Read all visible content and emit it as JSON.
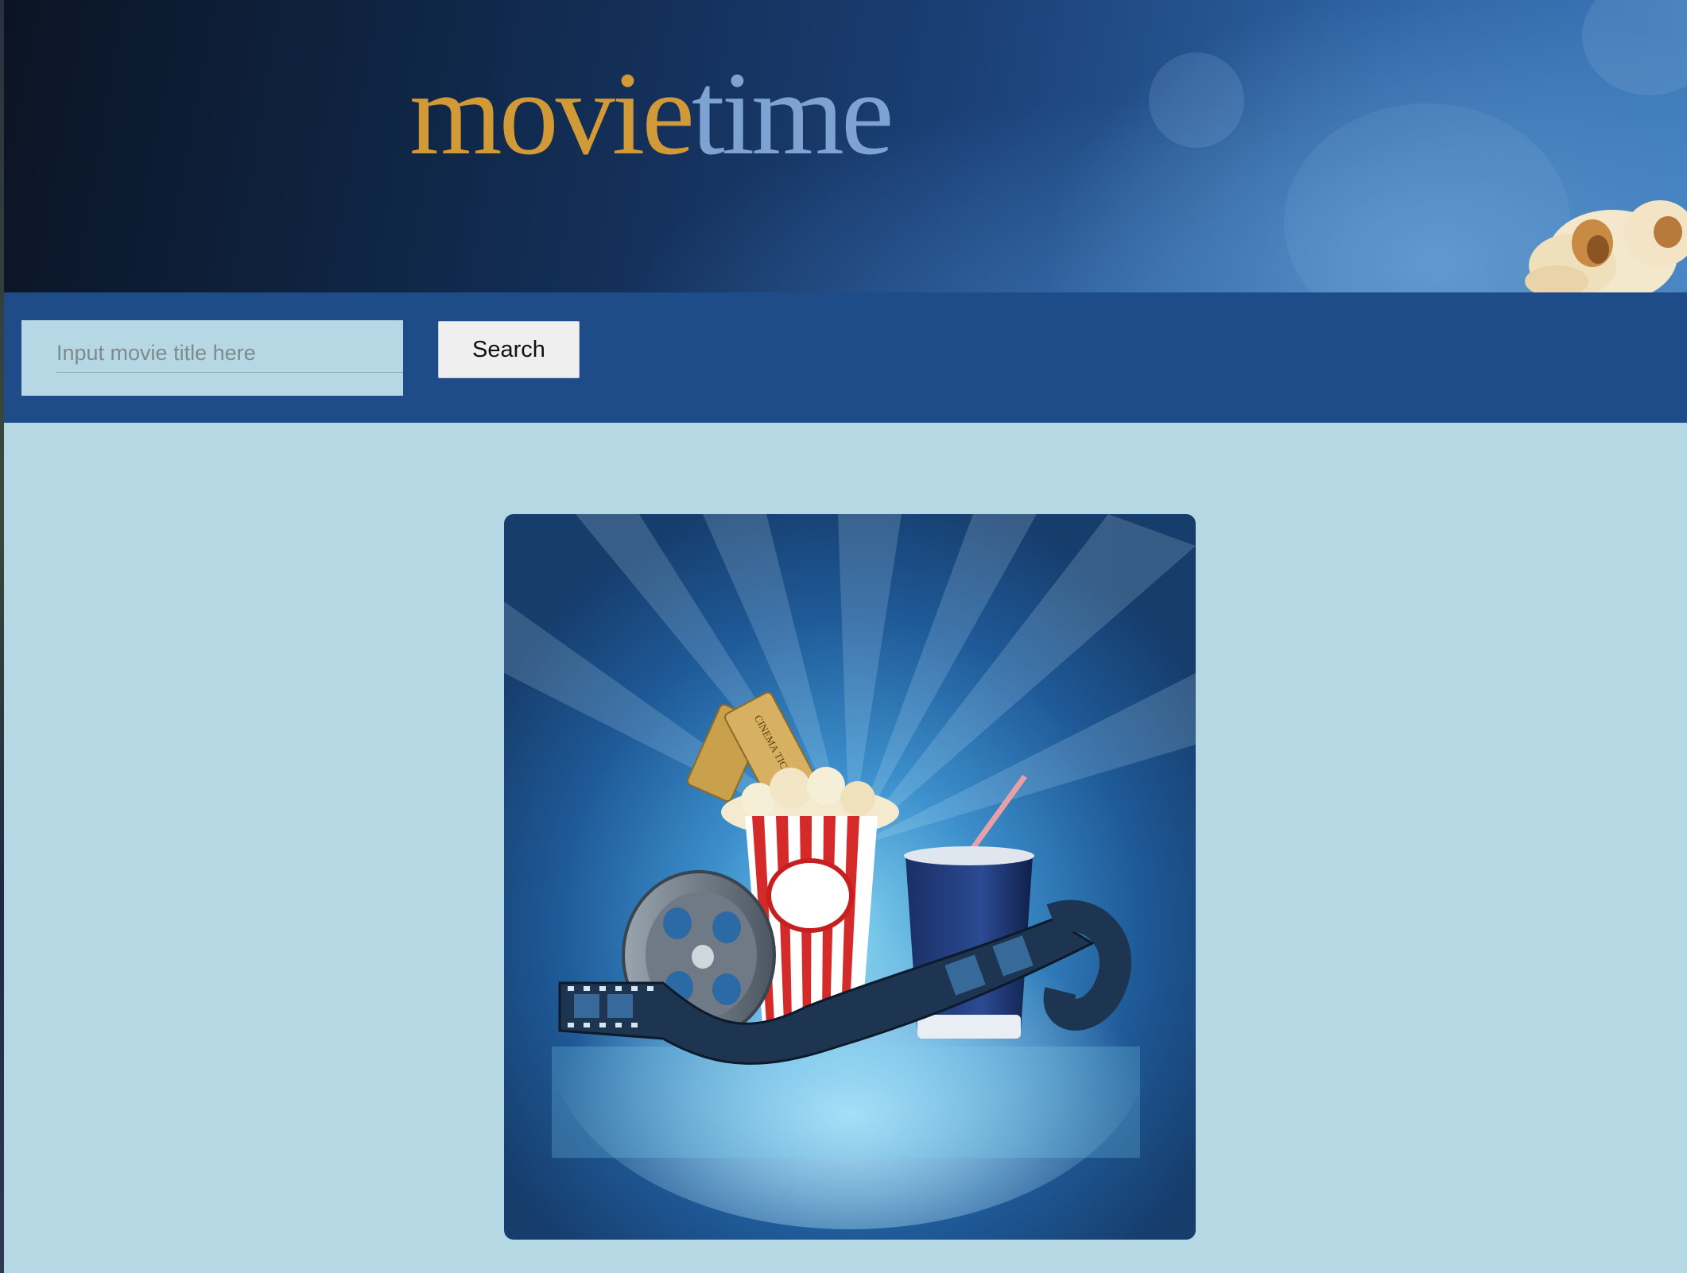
{
  "header": {
    "logo_part1": "movie",
    "logo_part2": "time"
  },
  "search": {
    "placeholder": "Input movie title here",
    "button_label": "Search"
  },
  "hero": {
    "ticket_text": "CINEMA TICKET"
  },
  "colors": {
    "banner_dark": "#0b1424",
    "banner_light": "#3f7cbc",
    "search_bar": "#1e4c88",
    "page_background": "#b6d8e4",
    "logo_gold": "#d19a37",
    "logo_blue": "#7ea3d2"
  },
  "icons": [
    "popcorn-icon",
    "cinema-ticket-icon",
    "popcorn-box-icon",
    "soda-cup-icon",
    "film-reel-icon",
    "film-strip-icon"
  ]
}
